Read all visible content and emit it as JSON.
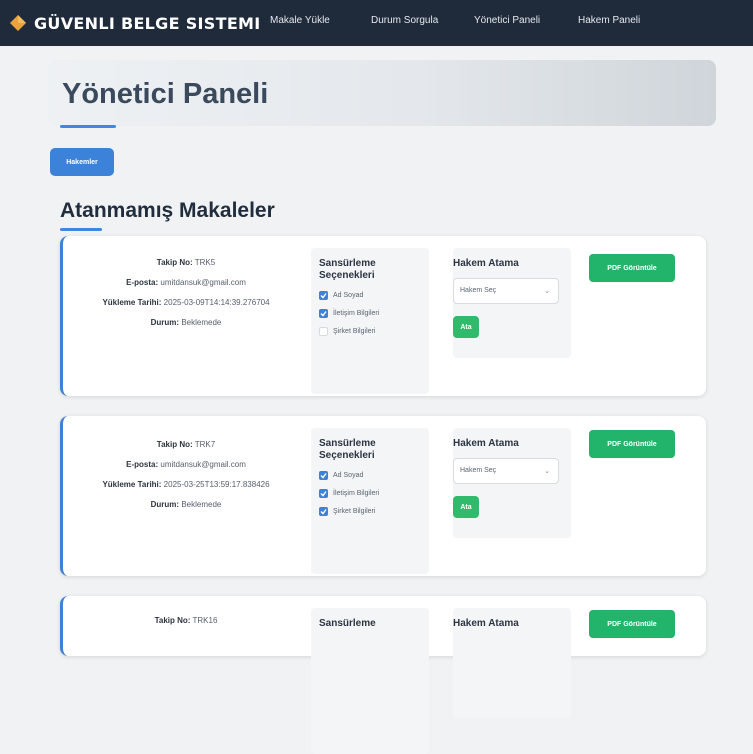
{
  "nav": {
    "brand": "GÜVENLI BELGE SISTEMI",
    "links": [
      "Makale Yükle",
      "Durum Sorgula",
      "Yönetici Paneli",
      "Hakem Paneli"
    ]
  },
  "page": {
    "title": "Yönetici Paneli",
    "tab": "Hakemler",
    "section_title": "Atanmamış Makaleler"
  },
  "labels": {
    "takip_no": "Takip No:",
    "eposta": "E-posta:",
    "yukleme_tarihi": "Yükleme Tarihi:",
    "durum": "Durum:",
    "censor_title": "Sansürleme Seçenekleri",
    "assign_title": "Hakem Atama",
    "select_placeholder": "Hakem Seç",
    "assign_button": "Ata",
    "pdf_button": "PDF Görüntüle"
  },
  "options": [
    "Ad Soyad",
    "İletişim Bilgileri",
    "Şirket Bilgileri"
  ],
  "cards": [
    {
      "takip_no": "TRK5",
      "eposta": "umitdansuk@gmail.com",
      "yukleme_tarihi": "2025-03-09T14:14:39.276704",
      "durum": "Beklemede",
      "checked": [
        true,
        true,
        false
      ]
    },
    {
      "takip_no": "TRK7",
      "eposta": "umitdansuk@gmail.com",
      "yukleme_tarihi": "2025-03-25T13:59:17.838426",
      "durum": "Beklemede",
      "checked": [
        true,
        true,
        true
      ]
    },
    {
      "takip_no": "TRK16",
      "eposta": "",
      "yukleme_tarihi": "",
      "durum": "",
      "checked": []
    }
  ],
  "colors": {
    "navbar": "#1f2a3a",
    "accent": "#3b82d8",
    "success": "#2fba6c",
    "brand_icon": "#e8a33c"
  }
}
